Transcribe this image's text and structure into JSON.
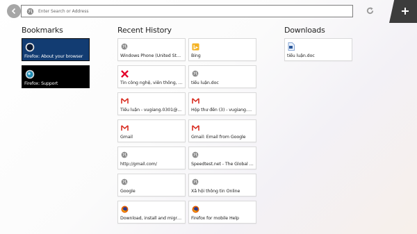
{
  "toolbar": {
    "url_placeholder": "Enter Search or Address",
    "icons": {
      "back": "back-arrow-icon",
      "globe": "globe-icon",
      "reload": "reload-icon",
      "new_tab": "plus-icon"
    }
  },
  "bookmarks": {
    "title": "Bookmarks",
    "items": [
      {
        "label": "Firefox: About your browser",
        "icon": "firefox-dark-icon",
        "bg": "#123c72"
      },
      {
        "label": "Firefox: Support",
        "icon": "firefox-globe-icon",
        "bg": "#000000"
      }
    ]
  },
  "history": {
    "title": "Recent History",
    "items": [
      {
        "label": "Windows Phone (United Stat...",
        "icon": "globe-icon"
      },
      {
        "label": "Bing",
        "icon": "bing-icon"
      },
      {
        "label": "Tin công nghệ, viễn thông, tr...",
        "icon": "tinhte-icon"
      },
      {
        "label": "tiểu luận.doc",
        "icon": "globe-icon"
      },
      {
        "label": "Tiểu luận - vugiang.0301@...",
        "icon": "gmail-icon"
      },
      {
        "label": "Hộp thư đến (3) - vugiang.0...",
        "icon": "gmail-icon"
      },
      {
        "label": "Gmail",
        "icon": "gmail-icon"
      },
      {
        "label": "Gmail: Email from Google",
        "icon": "gmail-icon"
      },
      {
        "label": "http://gmail.com/",
        "icon": "globe-icon"
      },
      {
        "label": "Speedtest.net - The Global B...",
        "icon": "globe-icon"
      },
      {
        "label": "Google",
        "icon": "globe-icon"
      },
      {
        "label": "Xã hội thông tin Online",
        "icon": "globe-icon"
      },
      {
        "label": "Download, install and migra...",
        "icon": "firefox-icon"
      },
      {
        "label": "Firefox for mobile Help",
        "icon": "firefox-icon"
      }
    ]
  },
  "downloads": {
    "title": "Downloads",
    "items": [
      {
        "label": "tiểu luận.doc",
        "icon": "word-doc-icon"
      }
    ]
  },
  "colors": {
    "bookmark_blue": "#123c72",
    "gmail_red": "#d93025",
    "bing_orange": "#f4b223",
    "firefox_orange": "#e66000",
    "tinhte_red": "#e4002b",
    "new_tab_bg": "#3c3c3c"
  }
}
